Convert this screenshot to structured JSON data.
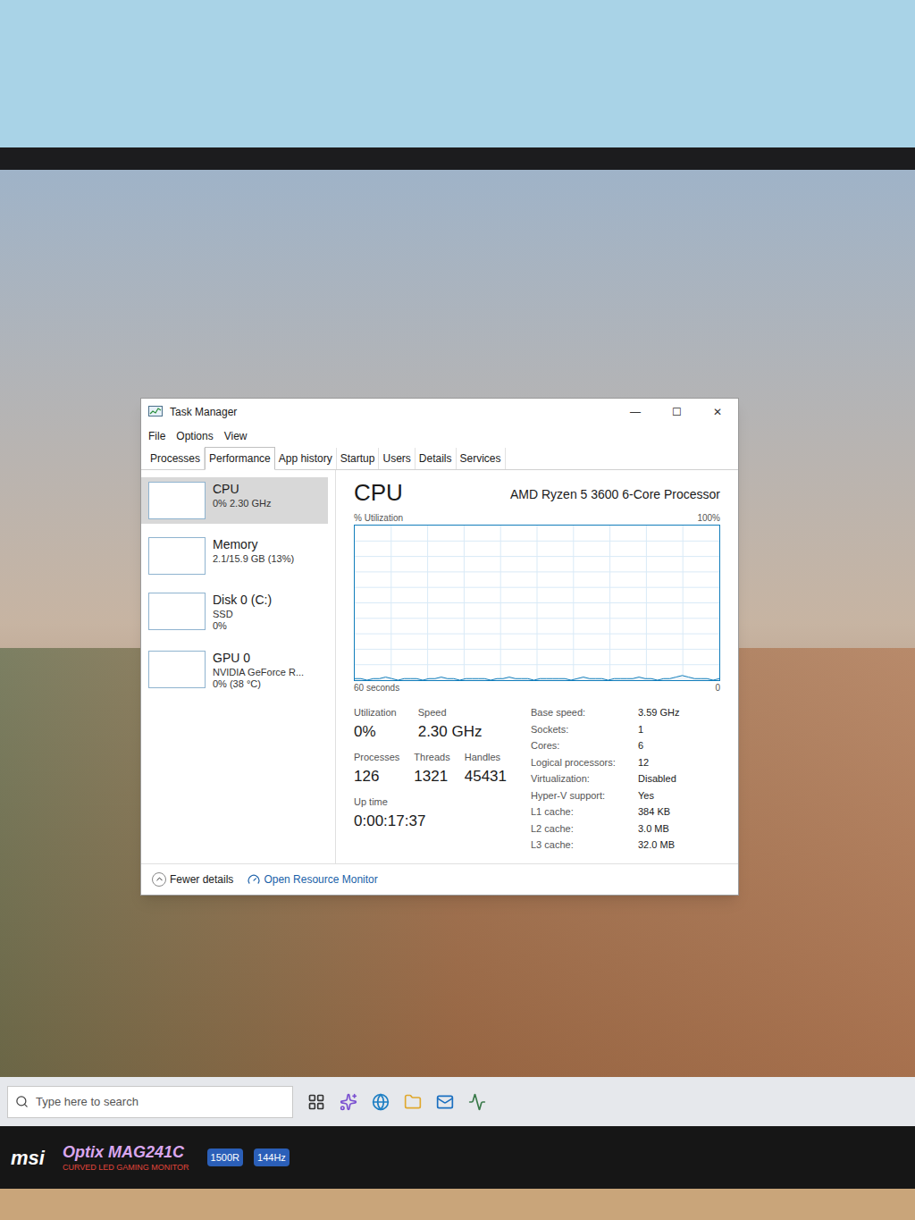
{
  "window": {
    "title": "Task Manager",
    "controls": [
      "—",
      "☐",
      "✕"
    ]
  },
  "menu": [
    "File",
    "Options",
    "View"
  ],
  "tabs": [
    {
      "label": "Processes",
      "selected": false
    },
    {
      "label": "Performance",
      "selected": true
    },
    {
      "label": "App history",
      "selected": false
    },
    {
      "label": "Startup",
      "selected": false
    },
    {
      "label": "Users",
      "selected": false
    },
    {
      "label": "Details",
      "selected": false
    },
    {
      "label": "Services",
      "selected": false
    }
  ],
  "sidebar": {
    "items": [
      {
        "name": "CPU",
        "lines": [
          "0% 2.30 GHz"
        ],
        "selected": true
      },
      {
        "name": "Memory",
        "lines": [
          "2.1/15.9 GB (13%)"
        ],
        "selected": false
      },
      {
        "name": "Disk 0 (C:)",
        "lines": [
          "SSD",
          "0%"
        ],
        "selected": false
      },
      {
        "name": "GPU 0",
        "lines": [
          "NVIDIA GeForce R...",
          "0% (38 °C)"
        ],
        "selected": false
      }
    ]
  },
  "cpu": {
    "title": "CPU",
    "model": "AMD Ryzen 5 3600 6-Core Processor",
    "axis_label": "% Utilization",
    "axis_max": "100%",
    "time_span": "60 seconds",
    "axis_min": "0",
    "series": [
      1,
      1,
      0,
      1,
      1,
      2,
      1,
      0,
      1,
      1,
      1,
      0,
      1,
      1,
      2,
      1,
      1,
      0,
      1,
      1,
      1,
      1,
      0,
      1,
      1,
      2,
      1,
      1,
      1,
      0,
      1,
      1,
      1,
      1,
      1,
      0,
      1,
      2,
      1,
      1,
      1,
      0,
      1,
      1,
      1,
      1,
      2,
      1,
      1,
      0,
      1,
      1,
      2,
      3,
      2,
      1,
      1,
      1,
      0,
      1
    ],
    "stats": [
      {
        "label": "Utilization",
        "value": "0%"
      },
      {
        "label": "Speed",
        "value": "2.30 GHz"
      }
    ],
    "stats2": [
      {
        "label": "Processes",
        "value": "126"
      },
      {
        "label": "Threads",
        "value": "1321"
      },
      {
        "label": "Handles",
        "value": "45431"
      }
    ],
    "uptime": {
      "label": "Up time",
      "value": "0:00:17:37"
    },
    "details": [
      {
        "label": "Base speed:",
        "value": "3.59 GHz"
      },
      {
        "label": "Sockets:",
        "value": "1"
      },
      {
        "label": "Cores:",
        "value": "6"
      },
      {
        "label": "Logical processors:",
        "value": "12"
      },
      {
        "label": "Virtualization:",
        "value": "Disabled"
      },
      {
        "label": "Hyper-V support:",
        "value": "Yes"
      },
      {
        "label": "L1 cache:",
        "value": "384 KB"
      },
      {
        "label": "L2 cache:",
        "value": "3.0 MB"
      },
      {
        "label": "L3 cache:",
        "value": "32.0 MB"
      }
    ]
  },
  "footer": {
    "fewer_details": "Fewer details",
    "resource_monitor": "Open Resource Monitor"
  },
  "taskbar": {
    "search_placeholder": "Type here to search"
  },
  "monitor": {
    "brand": "msi",
    "model": "Optix MAG241C",
    "tagline": "CURVED LED GAMING MONITOR",
    "badges": [
      "1500R",
      "144Hz"
    ]
  }
}
